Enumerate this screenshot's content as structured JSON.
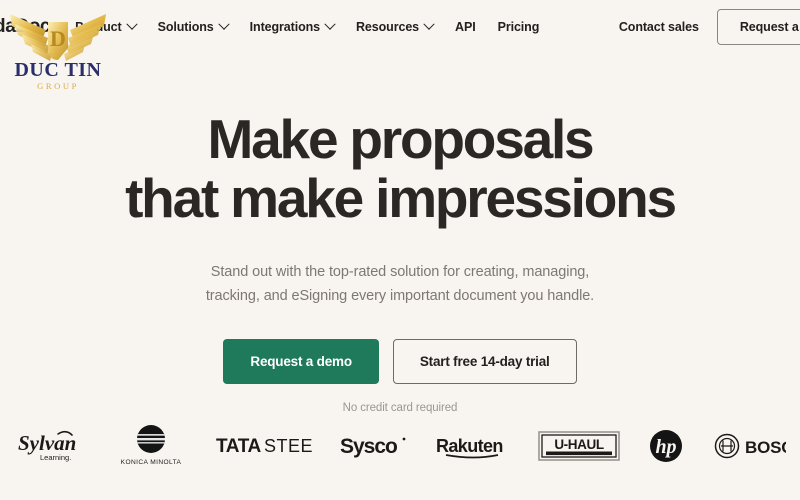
{
  "page": {
    "background_color": "#f8f4f0",
    "text_color": "#23211f"
  },
  "nav": {
    "brand_partial_text": "daDoc",
    "items": [
      {
        "label": "Product",
        "has_caret": true
      },
      {
        "label": "Solutions",
        "has_caret": true
      },
      {
        "label": "Integrations",
        "has_caret": true
      },
      {
        "label": "Resources",
        "has_caret": true
      },
      {
        "label": "API",
        "has_caret": false
      },
      {
        "label": "Pricing",
        "has_caret": false
      }
    ],
    "contact_sales_label": "Contact sales",
    "request_button_label": "Request a demo"
  },
  "watermark": {
    "name_line": "DUC TIN",
    "sub_line": "GROUP",
    "monogram": "D",
    "gold_color": "#e3b94a",
    "gold_light": "#f5dd86",
    "navy_color": "#2a2f6b"
  },
  "hero": {
    "heading_line1": "Make proposals",
    "heading_line2": "that make impressions",
    "subheading_line1": "Stand out with the top-rated solution for creating, managing,",
    "subheading_line2": "tracking, and eSigning every important document you handle.",
    "primary_cta": "Request a demo",
    "secondary_cta": "Start free 14-day trial",
    "primary_cta_color": "#1f7a5c",
    "disclaimer": "No credit card required"
  },
  "logo_strip": {
    "logos": [
      {
        "name": "sylvan-learning",
        "primary_text": "Sylvan",
        "secondary_text": "Learning."
      },
      {
        "name": "konica-minolta",
        "primary_text": "KONICA MINOLTA",
        "secondary_text": ""
      },
      {
        "name": "tata-steel",
        "primary_text": "TATA",
        "secondary_text": "STEEL"
      },
      {
        "name": "sysco",
        "primary_text": "Sysco",
        "secondary_text": ""
      },
      {
        "name": "rakuten",
        "primary_text": "Rakuten",
        "secondary_text": ""
      },
      {
        "name": "u-haul",
        "primary_text": "U-HAUL",
        "secondary_text": ""
      },
      {
        "name": "hp",
        "primary_text": "hp",
        "secondary_text": ""
      },
      {
        "name": "bosch",
        "primary_text": "BOSC",
        "secondary_text": ""
      }
    ]
  }
}
